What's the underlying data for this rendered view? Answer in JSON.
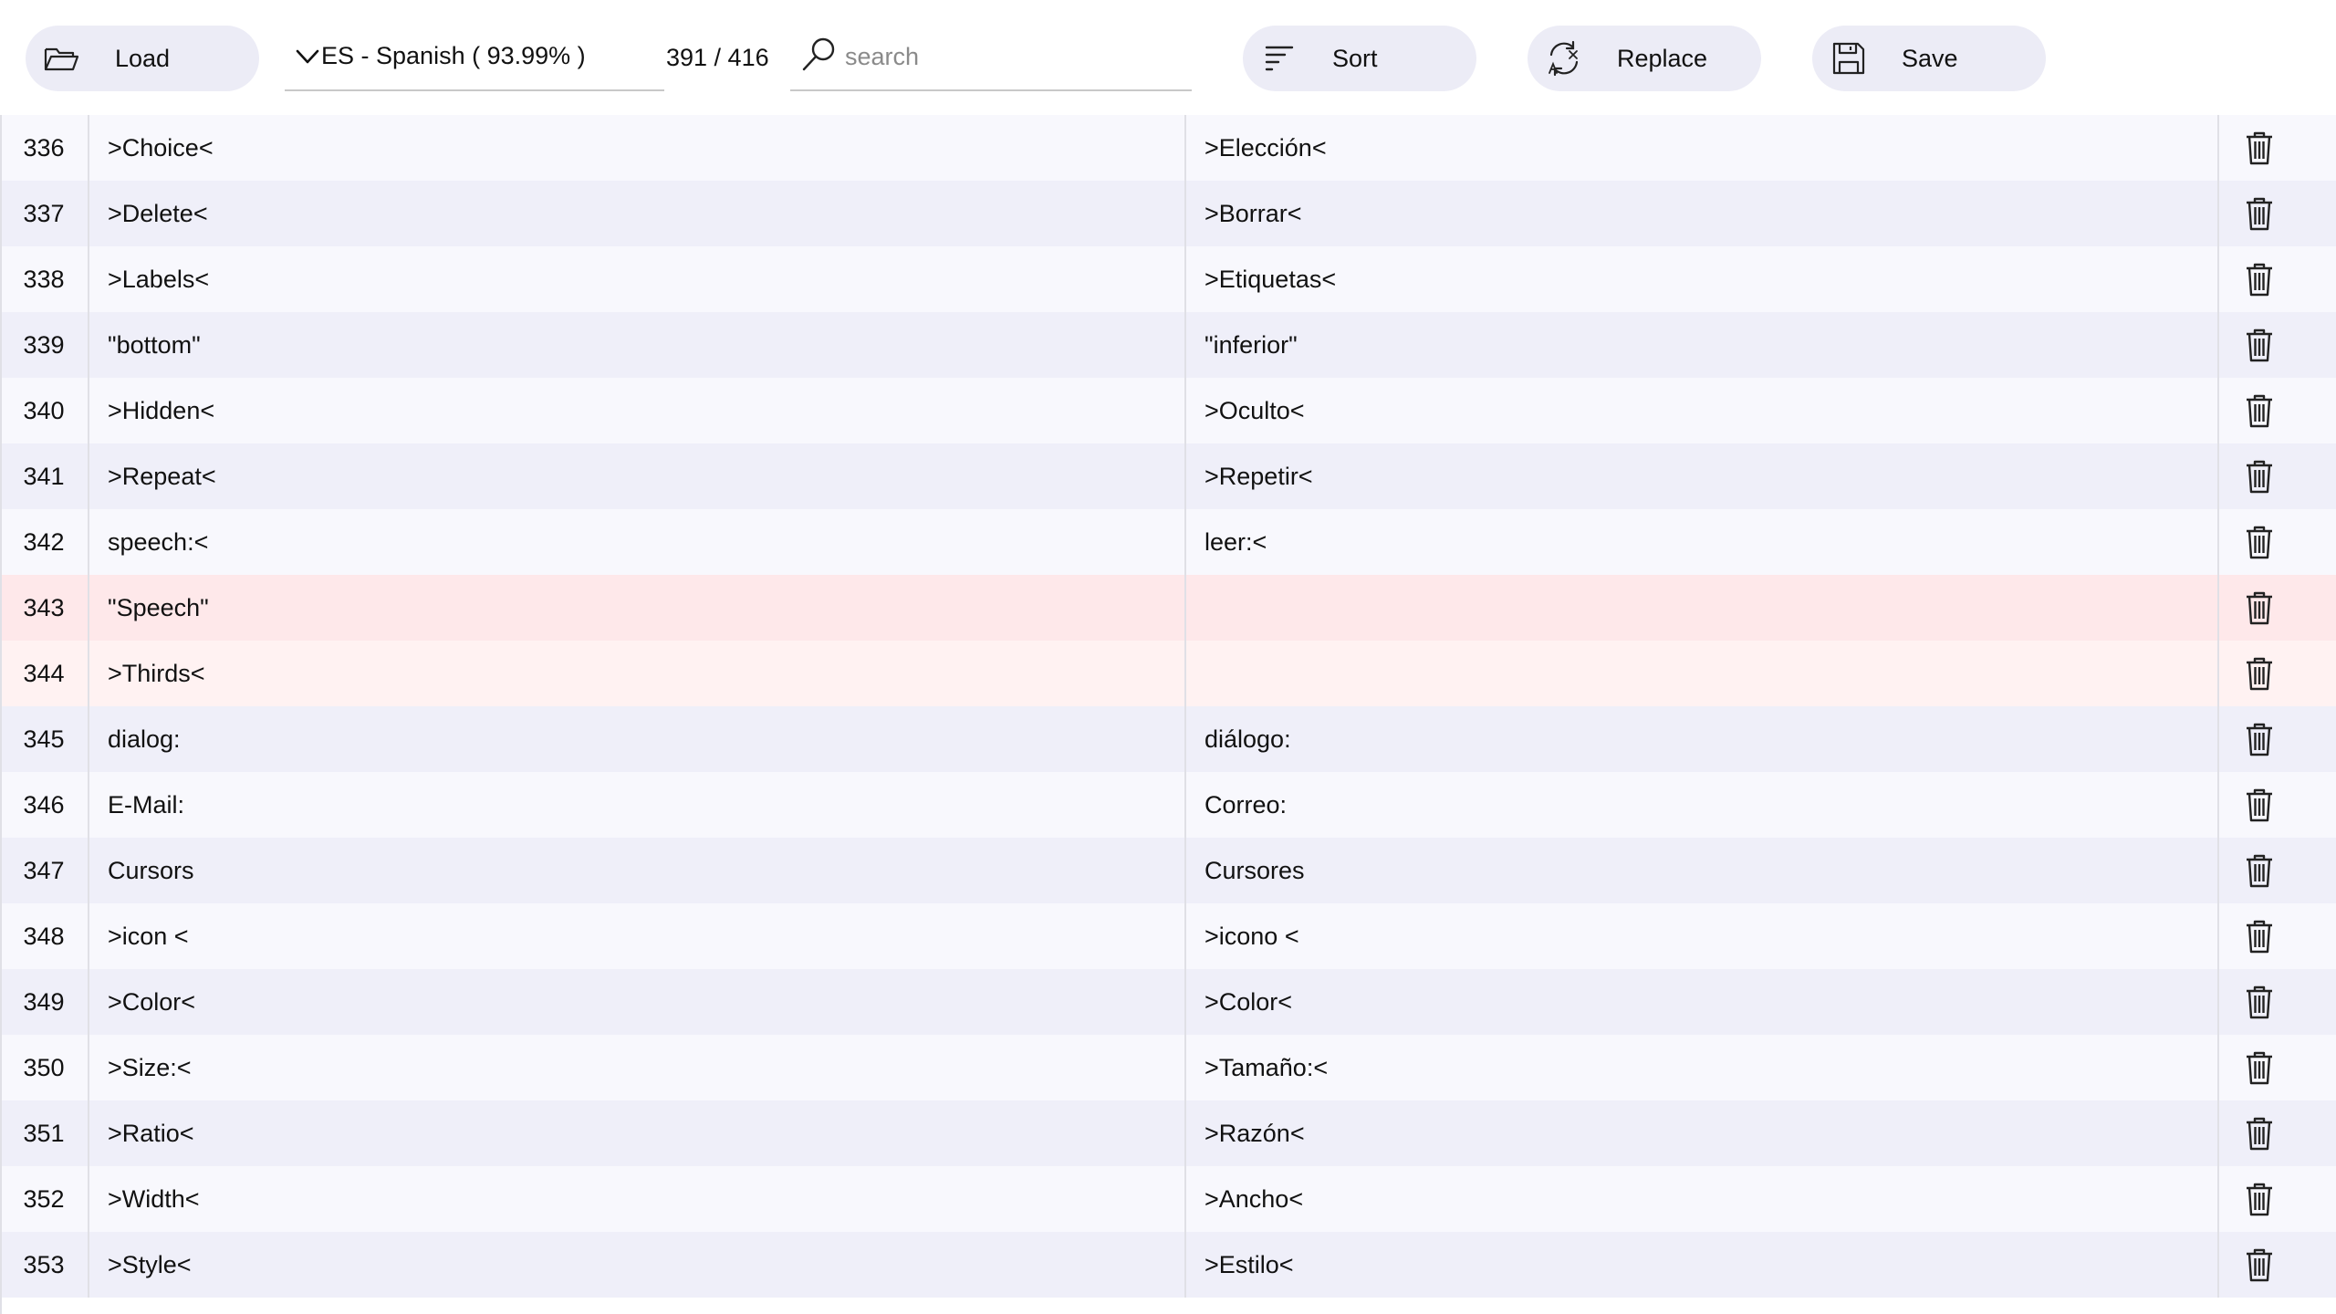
{
  "toolbar": {
    "load_label": "Load",
    "language": "ES - Spanish ( 93.99% )",
    "progress": "391 / 416",
    "search_placeholder": "search",
    "sort_label": "Sort",
    "replace_label": "Replace",
    "save_label": "Save"
  },
  "rows": [
    {
      "num": "336",
      "source": ">Choice<",
      "target": ">Elección<",
      "status": "ok"
    },
    {
      "num": "337",
      "source": ">Delete<",
      "target": ">Borrar<",
      "status": "ok"
    },
    {
      "num": "338",
      "source": ">Labels<",
      "target": ">Etiquetas<",
      "status": "ok"
    },
    {
      "num": "339",
      "source": "\"bottom\"",
      "target": "\"inferior\"",
      "status": "ok"
    },
    {
      "num": "340",
      "source": ">Hidden<",
      "target": ">Oculto<",
      "status": "ok"
    },
    {
      "num": "341",
      "source": ">Repeat<",
      "target": ">Repetir<",
      "status": "ok"
    },
    {
      "num": "342",
      "source": "speech:<",
      "target": "leer:<",
      "status": "ok"
    },
    {
      "num": "343",
      "source": "\"Speech\"",
      "target": "",
      "status": "missing"
    },
    {
      "num": "344",
      "source": ">Thirds<",
      "target": "",
      "status": "missing"
    },
    {
      "num": "345",
      "source": "dialog:",
      "target": "diálogo:",
      "status": "ok"
    },
    {
      "num": "346",
      "source": "E-Mail:",
      "target": "Correo:",
      "status": "ok"
    },
    {
      "num": "347",
      "source": "Cursors",
      "target": "Cursores",
      "status": "ok"
    },
    {
      "num": "348",
      "source": ">icon <",
      "target": ">icono <",
      "status": "ok"
    },
    {
      "num": "349",
      "source": ">Color<",
      "target": ">Color<",
      "status": "ok"
    },
    {
      "num": "350",
      "source": ">Size:<",
      "target": ">Tamaño:<",
      "status": "ok"
    },
    {
      "num": "351",
      "source": ">Ratio<",
      "target": ">Razón<",
      "status": "ok"
    },
    {
      "num": "352",
      "source": ">Width<",
      "target": ">Ancho<",
      "status": "ok"
    },
    {
      "num": "353",
      "source": ">Style<",
      "target": ">Estilo<",
      "status": "ok"
    }
  ],
  "colors": {
    "button_bg": "#ececf6",
    "row_odd": "#f8f8fd",
    "row_even": "#efeff9",
    "row_missing_a": "#fee8ea",
    "row_missing_b": "#fff2f2"
  },
  "icons": {
    "load": "folder-open-icon",
    "language": "chevron-down-icon",
    "search": "search-icon",
    "sort": "sort-lines-icon",
    "replace": "replace-icon",
    "save": "floppy-disk-icon",
    "delete": "trash-icon"
  }
}
